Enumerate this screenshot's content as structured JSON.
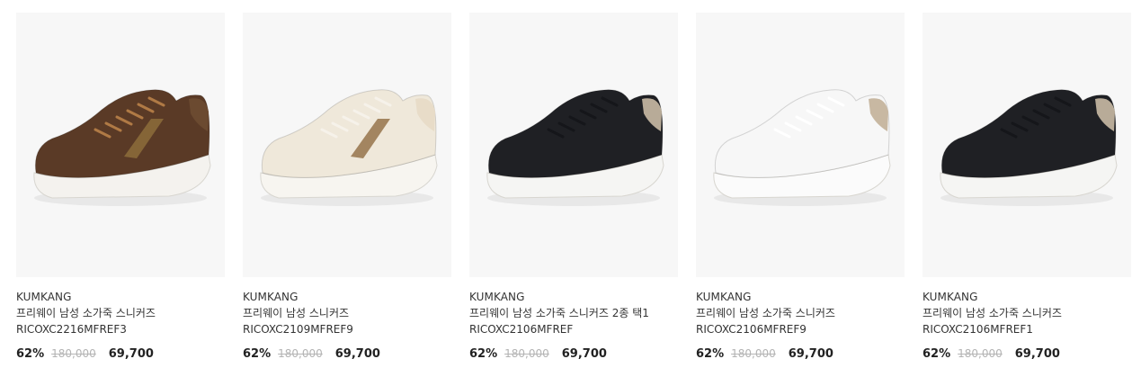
{
  "products": [
    {
      "brand": "KUMKANG",
      "name": "프리웨이 남성 소가죽 스니커즈 RICOXC2216MFREF3",
      "discount": "62%",
      "original_price": "180,000",
      "sale_price": "69,700",
      "image": "brown-leather-sneaker-with-stripe",
      "colors": {
        "upper": "#5a3a26",
        "lace": "#b07a45",
        "stripe": "#8a6a3a",
        "sole": "#f4f2ee",
        "heel": "#6b4a30"
      }
    },
    {
      "brand": "KUMKANG",
      "name": "프리웨이 남성 스니커즈 RICOXC2109MFREF9",
      "discount": "62%",
      "original_price": "180,000",
      "sale_price": "69,700",
      "image": "cream-leather-sneaker-with-stripe",
      "colors": {
        "upper": "#efe8da",
        "lace": "#f6f2ea",
        "stripe": "#9a7a52",
        "sole": "#f7f5f0",
        "heel": "#e8dcc8"
      }
    },
    {
      "brand": "KUMKANG",
      "name": "프리웨이 남성 소가죽 스니커즈 2종 택1 RICOXC2106MFREF",
      "discount": "62%",
      "original_price": "180,000",
      "sale_price": "69,700",
      "image": "black-leather-sneaker",
      "colors": {
        "upper": "#1f2024",
        "lace": "#15161a",
        "stripe": "#1f2024",
        "sole": "#f5f5f3",
        "heel": "#b8ab98"
      }
    },
    {
      "brand": "KUMKANG",
      "name": "프리웨이 남성 소가죽 스니커즈 RICOXC2106MFREF9",
      "discount": "62%",
      "original_price": "180,000",
      "sale_price": "69,700",
      "image": "white-leather-sneaker",
      "colors": {
        "upper": "#f7f7f7",
        "lace": "#ffffff",
        "stripe": "#f7f7f7",
        "sole": "#fbfbfb",
        "heel": "#c8b8a2"
      }
    },
    {
      "brand": "KUMKANG",
      "name": "프리웨이 남성 소가죽 스니커즈 RICOXC2106MFREF1",
      "discount": "62%",
      "original_price": "180,000",
      "sale_price": "69,700",
      "image": "black-leather-sneaker",
      "colors": {
        "upper": "#1f2024",
        "lace": "#15161a",
        "stripe": "#1f2024",
        "sole": "#f5f5f3",
        "heel": "#b8ab98"
      }
    }
  ]
}
